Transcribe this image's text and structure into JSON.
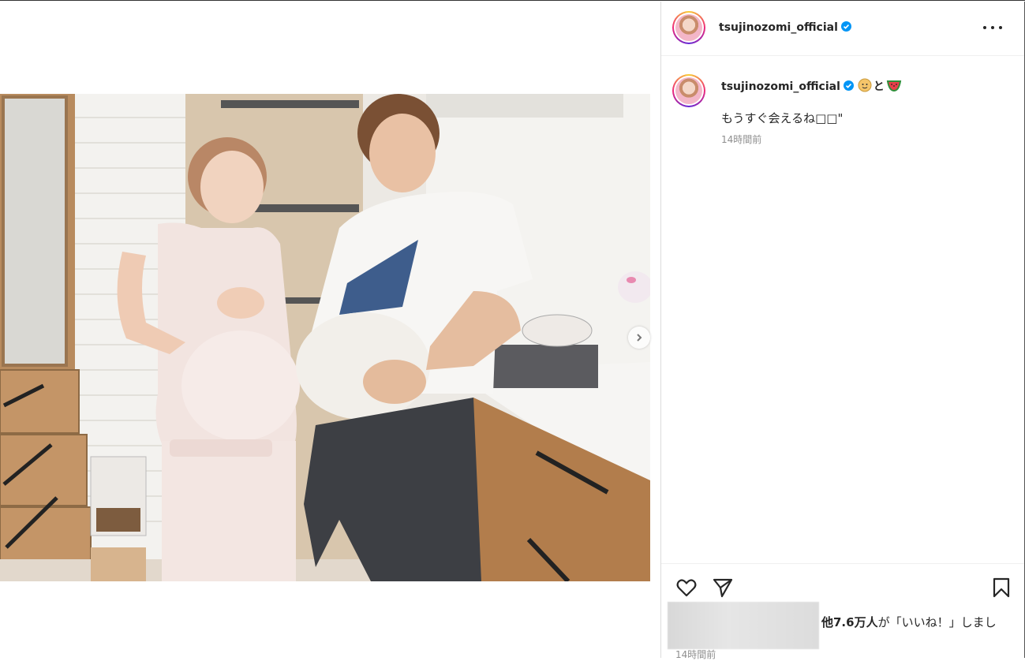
{
  "post": {
    "username": "tsujinozomi_official",
    "caption_user": "tsujinozomi_official",
    "caption_suffix": "と",
    "caption_text": "もうすぐ会えるね□□\"",
    "caption_time": "14時間前",
    "likes_count": "他7.6万人",
    "likes_suffix": "が「いいね！」しまし",
    "post_time": "14時間前"
  },
  "icons": {
    "verified": "verified-badge-icon",
    "more": "more-options-icon",
    "like": "heart-icon",
    "share": "send-icon",
    "save": "bookmark-icon",
    "next": "chevron-right-icon",
    "baby": "baby-emoji",
    "watermelon": "watermelon-emoji"
  },
  "colors": {
    "verified": "#0095f6",
    "text": "#262626",
    "secondary": "#8e8e8e",
    "border": "#dbdbdb"
  }
}
